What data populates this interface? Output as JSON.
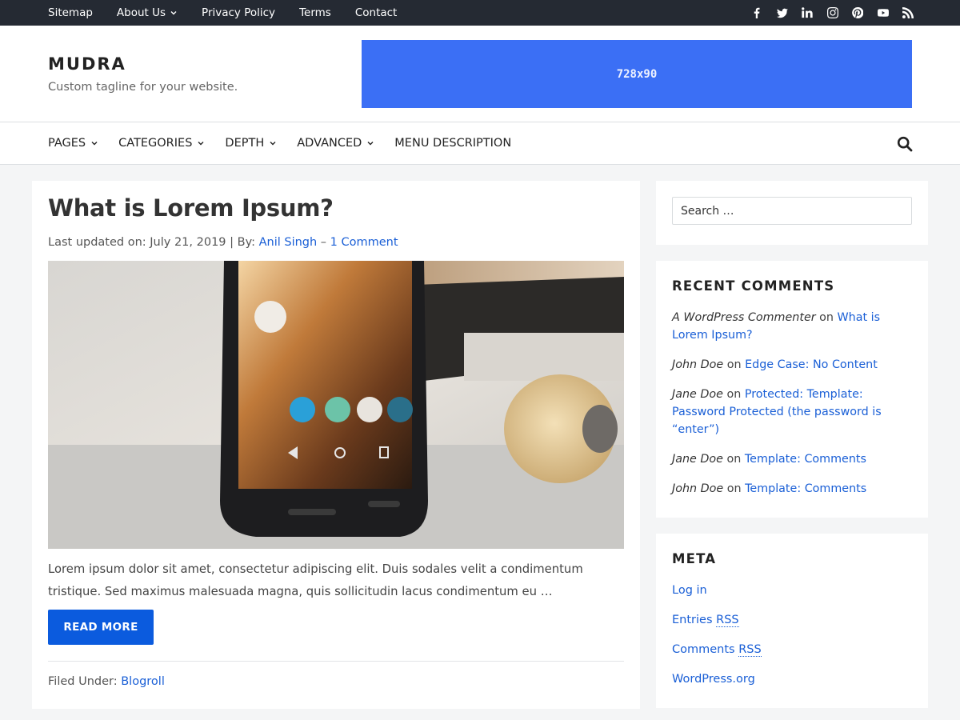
{
  "topbar": {
    "nav": [
      "Sitemap",
      "About Us",
      "Privacy Policy",
      "Terms",
      "Contact"
    ],
    "social": [
      "facebook-icon",
      "twitter-icon",
      "linkedin-icon",
      "instagram-icon",
      "pinterest-icon",
      "youtube-icon",
      "rss-icon"
    ]
  },
  "header": {
    "title": "MUDRA",
    "tagline": "Custom tagline for your website.",
    "ad_label": "728x90",
    "ad_color": "#3b6ff5"
  },
  "mainnav": {
    "items": [
      "PAGES",
      "CATEGORIES",
      "DEPTH",
      "ADVANCED",
      "MENU DESCRIPTION"
    ]
  },
  "post": {
    "title": "What is Lorem Ipsum?",
    "meta_prefix": "Last updated on: July 21, 2019 | By: ",
    "author": "Anil Singh",
    "meta_sep": " – ",
    "comments": "1 Comment",
    "excerpt": "Lorem ipsum dolor sit amet, consectetur adipiscing elit. Duis sodales velit a condimentum tristique. Sed maximus malesuada magna, quis sollicitudin lacus condimentum eu …",
    "read_more": "READ MORE",
    "filed_prefix": "Filed Under: ",
    "category": "Blogroll"
  },
  "sidebar": {
    "search_placeholder": "Search …",
    "recent_title": "RECENT COMMENTS",
    "recent": [
      {
        "author": "A WordPress Commenter",
        "on": " on ",
        "post": "What is Lorem Ipsum?"
      },
      {
        "author": "John Doe",
        "on": " on ",
        "post": "Edge Case: No Content"
      },
      {
        "author": "Jane Doe",
        "on": " on ",
        "post": "Protected: Template: Password Protected (the password is “enter”)"
      },
      {
        "author": "Jane Doe",
        "on": " on ",
        "post": "Template: Comments"
      },
      {
        "author": "John Doe",
        "on": " on ",
        "post": "Template: Comments"
      }
    ],
    "meta_title": "META",
    "meta": {
      "login": "Log in",
      "entries": "Entries ",
      "comments": "Comments ",
      "rss": "RSS",
      "wporg": "WordPress.org"
    }
  },
  "colors": {
    "topbar_bg": "#252a33",
    "link": "#1a5fd6",
    "button": "#0b5bde",
    "page_bg": "#f4f5f6"
  }
}
